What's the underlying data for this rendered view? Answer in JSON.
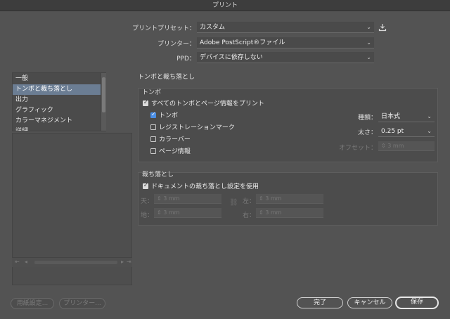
{
  "window": {
    "title": "プリント"
  },
  "preset": {
    "label": "プリントプリセット：",
    "value": "カスタム"
  },
  "printer": {
    "label": "プリンター：",
    "value": "Adobe PostScript®ファイル"
  },
  "ppd": {
    "label": "PPD：",
    "value": "デバイスに依存しない"
  },
  "sidebar": {
    "items": [
      {
        "label": "一般"
      },
      {
        "label": "トンボと裁ち落とし"
      },
      {
        "label": "出力"
      },
      {
        "label": "グラフィック"
      },
      {
        "label": "カラーマネジメント"
      },
      {
        "label": "詳細"
      }
    ],
    "selected_index": 1
  },
  "section": {
    "title": "トンボと裁ち落とし"
  },
  "marks": {
    "group_label": "トンボ",
    "all_marks": "すべてのトンボとページ情報をプリント",
    "crop": "トンボ",
    "registration": "レジストレーションマーク",
    "colorbar": "カラーバー",
    "pageinfo": "ページ情報",
    "type_label": "種類：",
    "type_value": "日本式",
    "weight_label": "太さ：",
    "weight_value": "0.25 pt",
    "offset_label": "オフセット：",
    "offset_value": "3 mm"
  },
  "bleed": {
    "group_label": "裁ち落とし",
    "use_doc": "ドキュメントの裁ち落とし設定を使用",
    "top_label": "天：",
    "top_value": "3 mm",
    "bottom_label": "地：",
    "bottom_value": "3 mm",
    "left_label": "左：",
    "left_value": "3 mm",
    "right_label": "右：",
    "right_value": "3 mm"
  },
  "buttons": {
    "page_setup": "用紙設定...",
    "printer": "プリンター...",
    "done": "完了",
    "cancel": "キャンセル",
    "save": "保存"
  }
}
